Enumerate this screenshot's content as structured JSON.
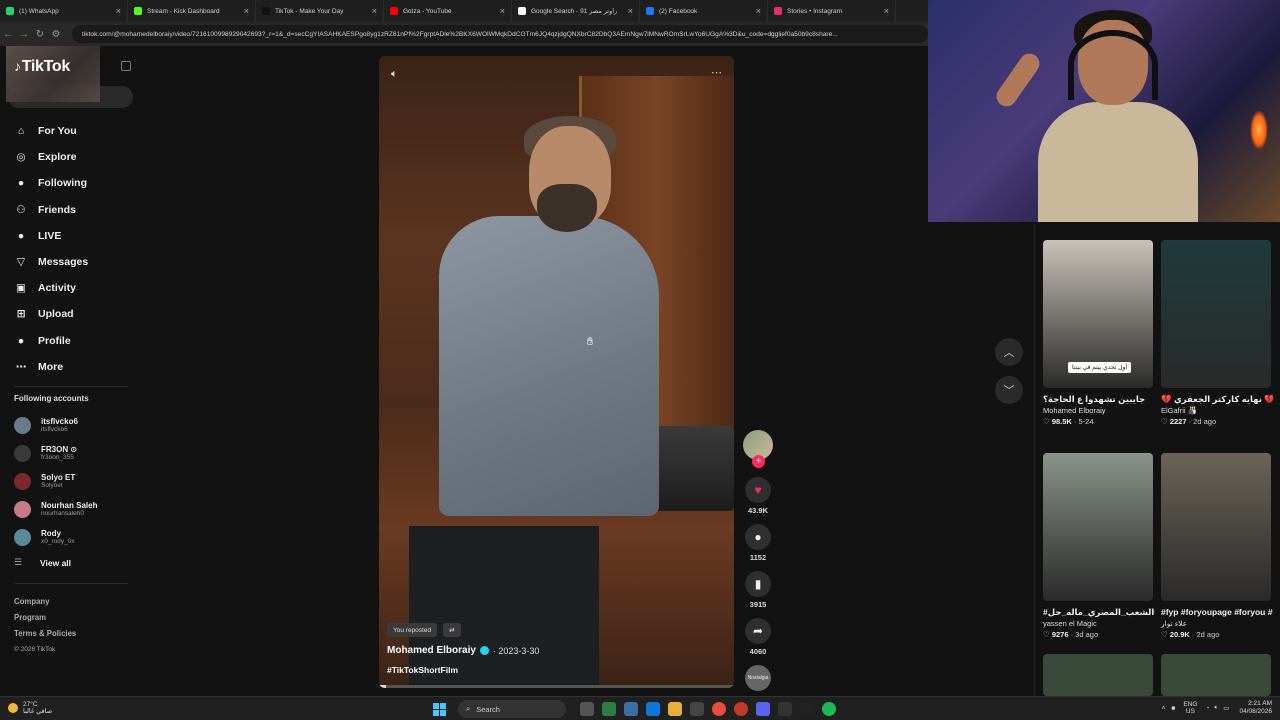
{
  "browser": {
    "tabs": [
      {
        "label": "(1) WhatsApp",
        "color": "#25d366"
      },
      {
        "label": "Stream - Kick Dashboard",
        "color": "#53fc18"
      },
      {
        "label": "TikTok - Make Your Day",
        "color": "#111111"
      },
      {
        "label": "Gotza - YouTube",
        "color": "#ff0000"
      },
      {
        "label": "Google Search - راوتر مصر 91",
        "color": "#ffffff"
      },
      {
        "label": "(2) Facebook",
        "color": "#1877f2"
      },
      {
        "label": "Stories • Instagram",
        "color": "#e1306c"
      }
    ],
    "url": "tiktok.com/@mohamedelboraiy/video/7216100998929042693?_r=1&_d=secCgYIASAHKAESPgo8yg1zRZ81nPf%2FgrptADle%2BKX6WOlWMqkDdCGTm6JQ4qzjdgQNXbrC82DbQ3AEmNgw7lMNwROmSrLwYo6UGgA%3D&u_code=dgglief0a50b9c8share..."
  },
  "sidebar": {
    "logo": "TikTok",
    "nav": [
      {
        "label": "For You",
        "icon": "home-icon"
      },
      {
        "label": "Explore",
        "icon": "compass-icon"
      },
      {
        "label": "Following",
        "icon": "following-icon"
      },
      {
        "label": "Friends",
        "icon": "friends-icon"
      },
      {
        "label": "LIVE",
        "icon": "live-icon"
      },
      {
        "label": "Messages",
        "icon": "messages-icon"
      },
      {
        "label": "Activity",
        "icon": "activity-icon"
      },
      {
        "label": "Upload",
        "icon": "upload-icon"
      },
      {
        "label": "Profile",
        "icon": "profile-icon"
      },
      {
        "label": "More",
        "icon": "more-icon"
      }
    ],
    "following_title": "Following accounts",
    "accounts": [
      {
        "name": "itsflvcko6",
        "handle": "itsflvcko6",
        "color": "#6a7a8a"
      },
      {
        "name": "FR3ON ⊙",
        "handle": "fr3oon_355",
        "color": "#3a3a3a"
      },
      {
        "name": "Solyo ET",
        "handle": "Solyoet",
        "color": "#7a2a2a"
      },
      {
        "name": "Nourhan Saleh",
        "handle": "nourhansaleh0",
        "color": "#c97a8a"
      },
      {
        "name": "Rody",
        "handle": "x0_rody_0x",
        "color": "#5a8a9a"
      }
    ],
    "view_all": "View all",
    "footer": {
      "company": "Company",
      "program": "Program",
      "terms": "Terms & Policies",
      "copyright": "© 2026 TikTok"
    }
  },
  "video": {
    "reposted": "You reposted",
    "author": "Mohamed Elboraiy",
    "date": "· 2023-3-30",
    "hashtag": "#TikTokShortFilm",
    "progress": 0.02,
    "likes": "43.9K",
    "comments": "1152",
    "saves": "3915",
    "shares": "4060",
    "music_label": "Nostalgia"
  },
  "related": [
    {
      "title": "جايبين تشهدوا ع الحاجة؟",
      "author": "Mohamed Elboraiy",
      "likes": "98.5K",
      "date": "5-24",
      "thumb": "#c9c2b8",
      "caption": "أول تحدي بيتم في بيتنا"
    },
    {
      "title": "💔 نهايه كاركتر الجعفري 💔 #fivem...",
      "author": "ElGafrii 🎳",
      "likes": "2227",
      "date": "2d ago",
      "thumb": "#1e3a3a",
      "caption": ""
    },
    {
      "title": "#الشعب_المصري_ماله_حل🤣 🤣 #tiktok #fyp...",
      "author": "yassen el Magic",
      "likes": "9276",
      "date": "3d ago",
      "thumb": "#8a948a",
      "caption": ""
    },
    {
      "title": "#fyp #foryoupage #foryou #viral...",
      "author": "علاء توار",
      "likes": "20.9K",
      "date": "2d ago",
      "thumb": "#6a6458",
      "caption": ""
    }
  ],
  "taskbar": {
    "weather_temp": "27°C",
    "weather_desc": "صافي غالبا",
    "search": "Search",
    "lang_top": "ENG",
    "lang_bottom": "US",
    "time": "2:21 AM",
    "date": "04/08/2026"
  }
}
